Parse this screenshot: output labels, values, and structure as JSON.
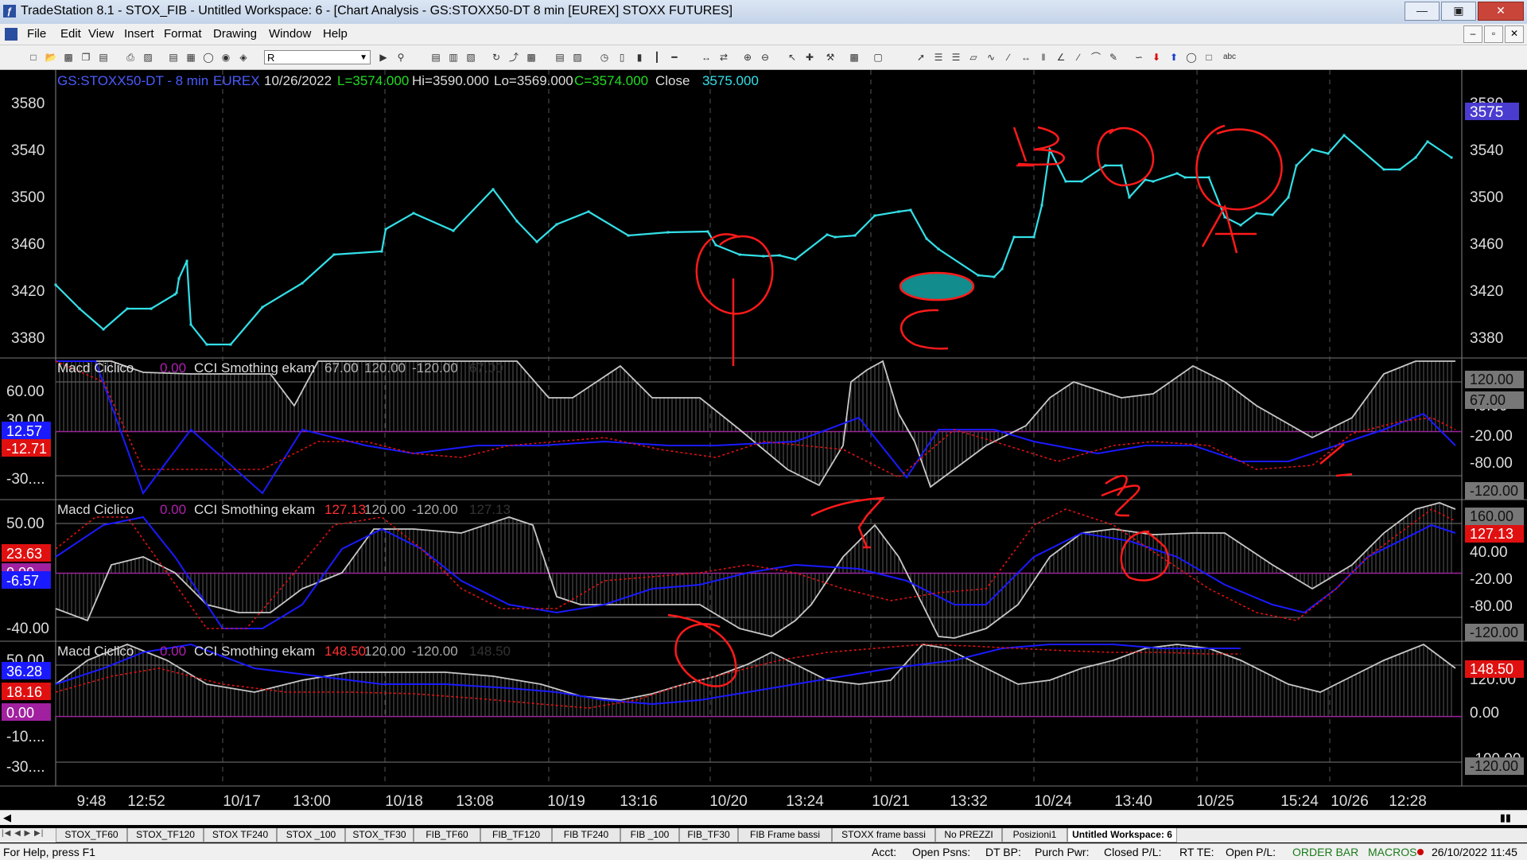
{
  "window": {
    "title": "TradeStation 8.1 - STOX_FIB - Untitled Workspace:  6 - [Chart Analysis - GS:STOXX50-DT  8 min  [EUREX] STOXX FUTURES]",
    "logo_icon": "tradestation-logo-icon",
    "controls": [
      "minimize-icon",
      "maximize-icon",
      "close-icon"
    ]
  },
  "menu": [
    "File",
    "Edit",
    "View",
    "Insert",
    "Format",
    "Drawing",
    "Window",
    "Help"
  ],
  "toolbar": {
    "symbol_value": "R",
    "icons": [
      "new-icon",
      "open-icon",
      "save-icon",
      "print-icon",
      "chart-icon",
      "radar-icon",
      "lock-icon",
      "globe-icon",
      "zoom-in-icon",
      "zoom-out-icon",
      "pointer-icon",
      "trendline-icon",
      "fibonacci-icon",
      "text-icon"
    ]
  },
  "chart": {
    "header": {
      "symbol": "GS:STOXX50-DT - 8 min",
      "exchange": "EUREX",
      "date": "10/26/2022",
      "last": "L=3574.000",
      "high": "Hi=3590.000",
      "low": "Lo=3569.000",
      "close_val": "C=3574.000",
      "close_label": "Close",
      "close_price": "3575.000"
    },
    "current_price_label": "3575",
    "price_axis": [
      "3580",
      "3540",
      "3500",
      "3460",
      "3420",
      "3380"
    ],
    "panels": [
      {
        "name": "Macd Ciclico",
        "zero": "0.00",
        "indicator": "CCI Smothing ekam",
        "value": "67.00",
        "upper": "120.00",
        "lower": "-120.00",
        "faded": "67.00",
        "left_axis": [
          "60.00",
          "30.00",
          "0.00",
          "-30...."
        ],
        "left_badges": [
          "12.57",
          "-12.71"
        ],
        "right_axis": [
          "40.00",
          "-20.00",
          "-80.00"
        ],
        "right_badges": [
          "120.00",
          "67.00",
          "-120.00"
        ]
      },
      {
        "name": "Macd Ciclico",
        "zero": "0.00",
        "indicator": "CCI Smothing ekam",
        "value": "127.13",
        "upper": "120.00",
        "lower": "-120.00",
        "faded": "127.13",
        "left_axis": [
          "50.00",
          "0.00",
          "-40.00"
        ],
        "left_badges": [
          "23.63",
          "0.00",
          "-6.57"
        ],
        "right_axis": [
          "100.00",
          "40.00",
          "-20.00",
          "-80.00"
        ],
        "right_badges": [
          "160.00",
          "127.13",
          "-120.00"
        ]
      },
      {
        "name": "Macd Ciclico",
        "zero": "0.00",
        "indicator": "CCI Smothing ekam",
        "value": "148.50",
        "upper": "120.00",
        "lower": "-120.00",
        "faded": "148.50",
        "left_axis": [
          "50.00",
          "-10....",
          "-30...."
        ],
        "left_badges": [
          "36.28",
          "18.16",
          "0.00"
        ],
        "right_axis": [
          "120.00",
          "0.00",
          "-100.00"
        ],
        "right_badges": [
          "148.50",
          "-120.00"
        ]
      }
    ],
    "time_axis": [
      "9:48",
      "12:52",
      "10/17",
      "13:00",
      "10/18",
      "13:08",
      "10/19",
      "13:16",
      "10/20",
      "13:24",
      "10/21",
      "13:32",
      "10/24",
      "13:40",
      "10/25",
      "15:24",
      "10/26",
      "12:28"
    ],
    "annotations": [
      "B",
      "A",
      "C",
      "1",
      "2"
    ],
    "colors": {
      "price": "#33e0e8",
      "macd_blue": "#1a1aff",
      "macd_red": "#e01010",
      "cci_gray": "#c8c8c8",
      "zero_line": "#a020a0",
      "annotation": "#ff1a1a",
      "header_blue": "#4a5cff",
      "header_green": "#22dd22",
      "header_cyan": "#33e0e8"
    }
  },
  "workspace_tabs": [
    "STOX_TF60",
    "STOX_TF120",
    "STOX TF240",
    "STOX _100",
    "STOX_TF30",
    "FIB_TF60",
    "FIB_TF120",
    "FIB TF240",
    "FIB _100",
    "FIB_TF30",
    "FIB Frame bassi",
    "STOXX frame bassi",
    "No PREZZI",
    "Posizioni1",
    "Untitled Workspace:  6"
  ],
  "status": {
    "help": "For Help, press F1",
    "acct": "Acct:",
    "open_psns": "Open Psns:",
    "dt_bp": "DT BP:",
    "purch_pwr": "Purch Pwr:",
    "closed_pl": "Closed P/L:",
    "rt_te": "RT TE:",
    "open_pl": "Open P/L:",
    "order_bar": "ORDER BAR",
    "macros": "MACROS",
    "datetime": "26/10/2022 11:45"
  }
}
